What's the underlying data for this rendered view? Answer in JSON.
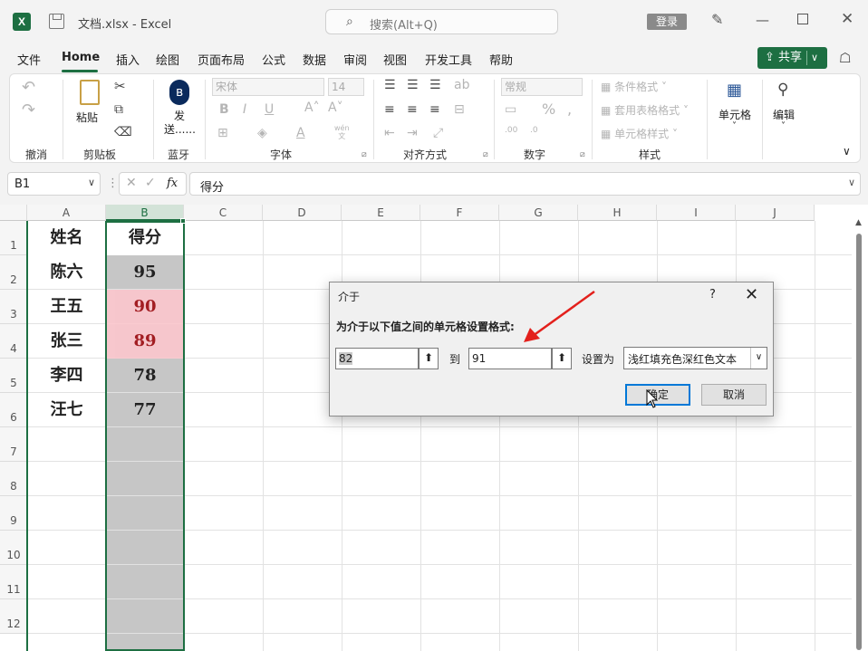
{
  "window": {
    "title": "文档.xlsx  -  Excel",
    "login_label": "登录"
  },
  "search": {
    "text": "搜索(Alt+Q)"
  },
  "menu": {
    "file": "文件",
    "home": "Home",
    "insert": "插入",
    "draw": "绘图",
    "layout": "页面布局",
    "formulas": "公式",
    "data": "数据",
    "review": "审阅",
    "view": "视图",
    "developer": "开发工具",
    "help": "帮助"
  },
  "share": {
    "label": "共享"
  },
  "ribbon": {
    "groups": {
      "undo": "撤消",
      "clipboard": "剪贴板",
      "bluetooth": "蓝牙",
      "font": "字体",
      "alignment": "对齐方式",
      "number": "数字",
      "styles": "样式"
    },
    "paste": "粘贴",
    "send": "发\n送......",
    "font_name": "宋体",
    "font_size": "14",
    "number_format": "常规",
    "conditional_format": "条件格式",
    "table_format": "套用表格格式",
    "cell_style": "单元格样式",
    "cells": "单元格",
    "editing": "编辑",
    "wen": "wén",
    "wen_char": "文"
  },
  "formula_bar": {
    "name_box": "B1",
    "formula": "得分",
    "fx": "fx"
  },
  "columns": [
    "A",
    "B",
    "C",
    "D",
    "E",
    "F",
    "G",
    "H",
    "I",
    "J"
  ],
  "rows": [
    "1",
    "2",
    "3",
    "4",
    "5",
    "6",
    "7",
    "8",
    "9",
    "10",
    "11",
    "12"
  ],
  "sheet": {
    "header": {
      "name": "姓名",
      "score": "得分"
    },
    "records": [
      {
        "name": "陈六",
        "score": "95",
        "highlight": false
      },
      {
        "name": "王五",
        "score": "90",
        "highlight": true
      },
      {
        "name": "张三",
        "score": "89",
        "highlight": true
      },
      {
        "name": "李四",
        "score": "78",
        "highlight": false
      },
      {
        "name": "汪七",
        "score": "77",
        "highlight": false
      }
    ]
  },
  "dialog": {
    "title": "介于",
    "help": "?",
    "prompt": "为介于以下值之间的单元格设置格式:",
    "from_value": "82",
    "to_label": "到",
    "to_value": "91",
    "set_as_label": "设置为",
    "format_option": "浅红填充色深红色文本",
    "ok_label": "确定",
    "cancel_label": "取消"
  },
  "colors": {
    "accent": "#1d6f42",
    "highlight_fill": "#ffc7ce",
    "highlight_text": "#9c0006",
    "selected_col": "#c6c6c6"
  }
}
